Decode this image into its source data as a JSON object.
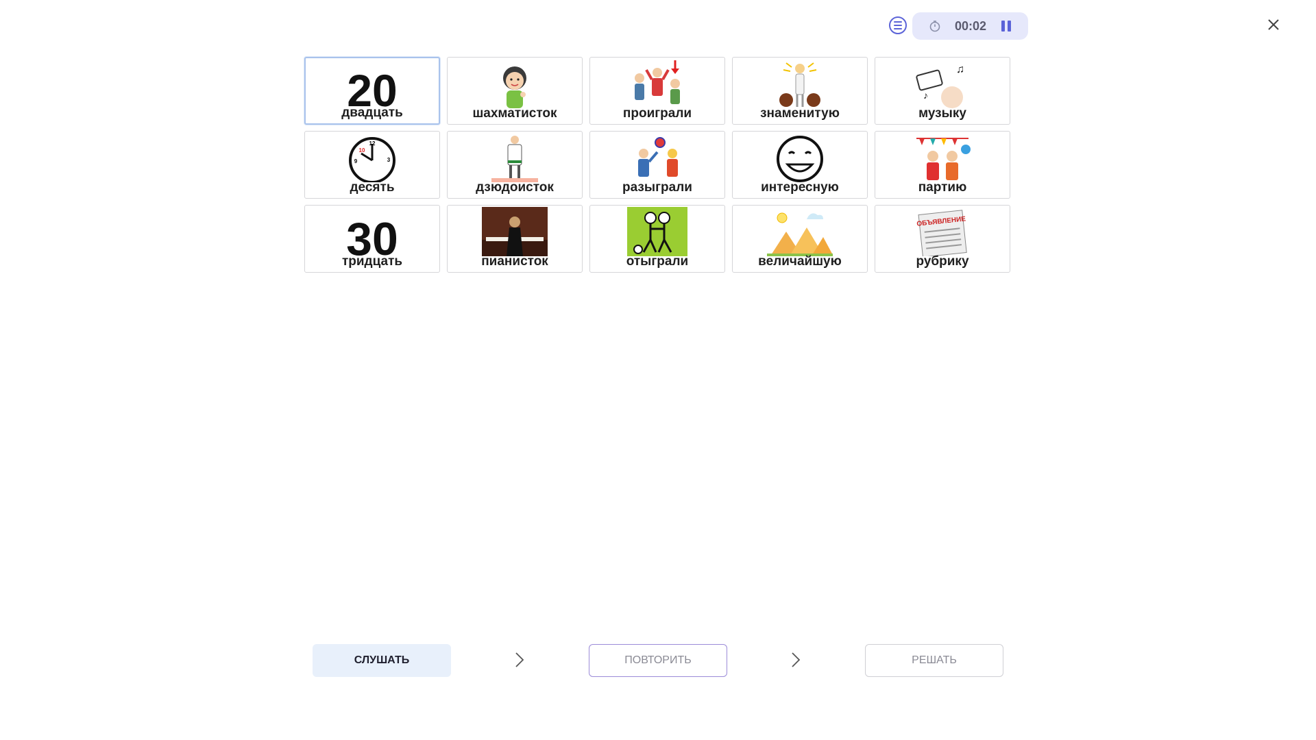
{
  "header": {
    "timer": "00:02",
    "menu_icon": "list-menu-icon",
    "timer_icon": "stopwatch-icon",
    "pause_icon": "pause-icon",
    "close_icon": "close-icon"
  },
  "cards": [
    {
      "label": "двадцать",
      "icon": "number-20",
      "digits": "20",
      "selected": true
    },
    {
      "label": "шахматисток",
      "icon": "girl-portrait"
    },
    {
      "label": "проиграли",
      "icon": "children-lost"
    },
    {
      "label": "знаменитую",
      "icon": "famous-woman"
    },
    {
      "label": "музыку",
      "icon": "radio-music"
    },
    {
      "label": "десять",
      "icon": "clock-ten"
    },
    {
      "label": "дзюдоисток",
      "icon": "judoka"
    },
    {
      "label": "разыграли",
      "icon": "children-playing-ball"
    },
    {
      "label": "интересную",
      "icon": "smiling-face"
    },
    {
      "label": "партию",
      "icon": "party-children"
    },
    {
      "label": "тридцать",
      "icon": "number-30",
      "digits": "30"
    },
    {
      "label": "пианисток",
      "icon": "pianist-photo"
    },
    {
      "label": "отыграли",
      "icon": "stick-figures-ball"
    },
    {
      "label": "величайшую",
      "icon": "pyramids"
    },
    {
      "label": "рубрику",
      "icon": "newspaper",
      "stamp_text": "ОБЪЯВЛЕНИЕ"
    }
  ],
  "footer": {
    "listen_label": "СЛУШАТЬ",
    "repeat_label": "ПОВТОРИТЬ",
    "solve_label": "РЕШАТЬ"
  },
  "colors": {
    "accent": "#5b63d8",
    "pill_bg": "#e6e8fb",
    "listen_bg": "#e8f0fb",
    "selected_border": "#a9c3ec"
  }
}
